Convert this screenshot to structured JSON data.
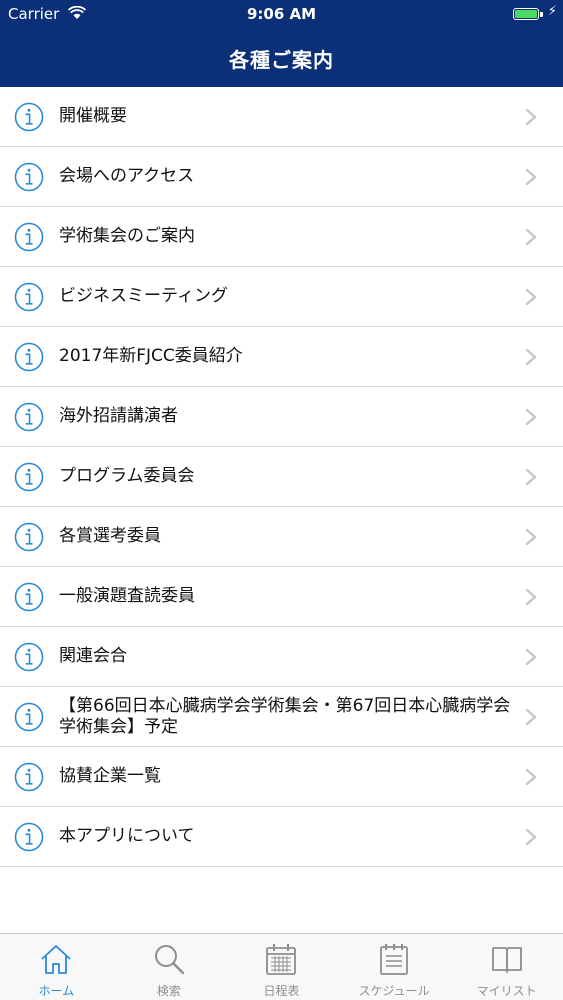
{
  "status_bar": {
    "carrier": "Carrier",
    "time": "9:06 AM",
    "battery_color": "#4cd964"
  },
  "nav": {
    "title": "各種ご案内",
    "background_color": "#0b3077"
  },
  "list": {
    "accent_color": "#2a8ad8",
    "items": [
      {
        "label": "開催概要",
        "icon": "info-icon"
      },
      {
        "label": "会場へのアクセス",
        "icon": "info-icon"
      },
      {
        "label": "学術集会のご案内",
        "icon": "info-icon"
      },
      {
        "label": "ビジネスミーティング",
        "icon": "info-icon"
      },
      {
        "label": "2017年新FJCC委員紹介",
        "icon": "info-icon"
      },
      {
        "label": "海外招請講演者",
        "icon": "info-icon"
      },
      {
        "label": "プログラム委員会",
        "icon": "info-icon"
      },
      {
        "label": "各賞選考委員",
        "icon": "info-icon"
      },
      {
        "label": "一般演題査読委員",
        "icon": "info-icon"
      },
      {
        "label": "関連会合",
        "icon": "info-icon"
      },
      {
        "label": "【第66回日本心臓病学会学術集会・第67回日本心臓病学会学術集会】予定",
        "icon": "info-icon"
      },
      {
        "label": "協賛企業一覧",
        "icon": "info-icon"
      },
      {
        "label": "本アプリについて",
        "icon": "info-icon"
      }
    ]
  },
  "tabbar": {
    "tabs": [
      {
        "label": "ホーム",
        "icon": "home-icon",
        "active": true
      },
      {
        "label": "検索",
        "icon": "search-icon",
        "active": false
      },
      {
        "label": "日程表",
        "icon": "calendar-icon",
        "active": false
      },
      {
        "label": "スケジュール",
        "icon": "clipboard-icon",
        "active": false
      },
      {
        "label": "マイリスト",
        "icon": "book-icon",
        "active": false
      }
    ]
  }
}
